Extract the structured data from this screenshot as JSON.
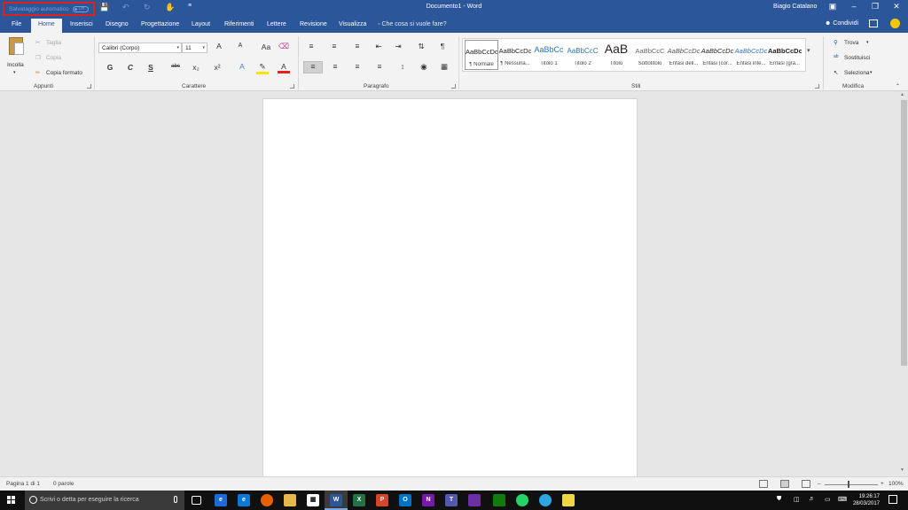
{
  "titlebar": {
    "autosave_label": "Salvataggio automatico",
    "autosave_state": "Off",
    "document_title": "Documento1 - Word",
    "user_name": "Biagio Catalano"
  },
  "tabs": [
    "File",
    "Home",
    "Inserisci",
    "Disegno",
    "Progettazione",
    "Layout",
    "Riferimenti",
    "Lettere",
    "Revisione",
    "Visualizza"
  ],
  "tell_me": "Che cosa si vuole fare?",
  "share_label": "Condividi",
  "ribbon": {
    "clipboard": {
      "paste": "Incolla",
      "cut": "Taglia",
      "copy": "Copia",
      "format_painter": "Copia formato",
      "label": "Appunti"
    },
    "font": {
      "font_name": "Calibri (Corpo)",
      "font_size": "11",
      "bold": "G",
      "italic": "C",
      "underline": "S",
      "strike": "abc",
      "subscript": "x₂",
      "superscript": "x²",
      "grow": "A",
      "shrink": "A",
      "case": "Aa",
      "label": "Carattere"
    },
    "paragraph": {
      "label": "Paragrafo"
    },
    "styles": {
      "label": "Stili",
      "items": [
        {
          "sample": "AaBbCcDc",
          "name": "¶ Normale"
        },
        {
          "sample": "AaBbCcDc",
          "name": "¶ Nessuna..."
        },
        {
          "sample": "AaBbCc",
          "name": "Titolo 1"
        },
        {
          "sample": "AaBbCcC",
          "name": "Titolo 2"
        },
        {
          "sample": "AaB",
          "name": "Titolo"
        },
        {
          "sample": "AaBbCcC",
          "name": "Sottotitolo"
        },
        {
          "sample": "AaBbCcDc",
          "name": "Enfasi deli..."
        },
        {
          "sample": "AaBbCcDc",
          "name": "Enfasi (cor..."
        },
        {
          "sample": "AaBbCcDc",
          "name": "Enfasi inte..."
        },
        {
          "sample": "AaBbCcDc",
          "name": "Enfasi (gra..."
        }
      ]
    },
    "editing": {
      "find": "Trova",
      "replace": "Sostituisci",
      "select": "Seleziona",
      "label": "Modifica"
    }
  },
  "statusbar": {
    "page": "Pagina 1 di 1",
    "words": "0 parole",
    "zoom": "100%"
  },
  "taskbar": {
    "search_placeholder": "Scrivi o detta per eseguire la ricerca",
    "time": "19:26:17",
    "date": "28/03/2017"
  },
  "colors": {
    "word_blue": "#2b579a",
    "highlight_red": "#e0201b"
  }
}
